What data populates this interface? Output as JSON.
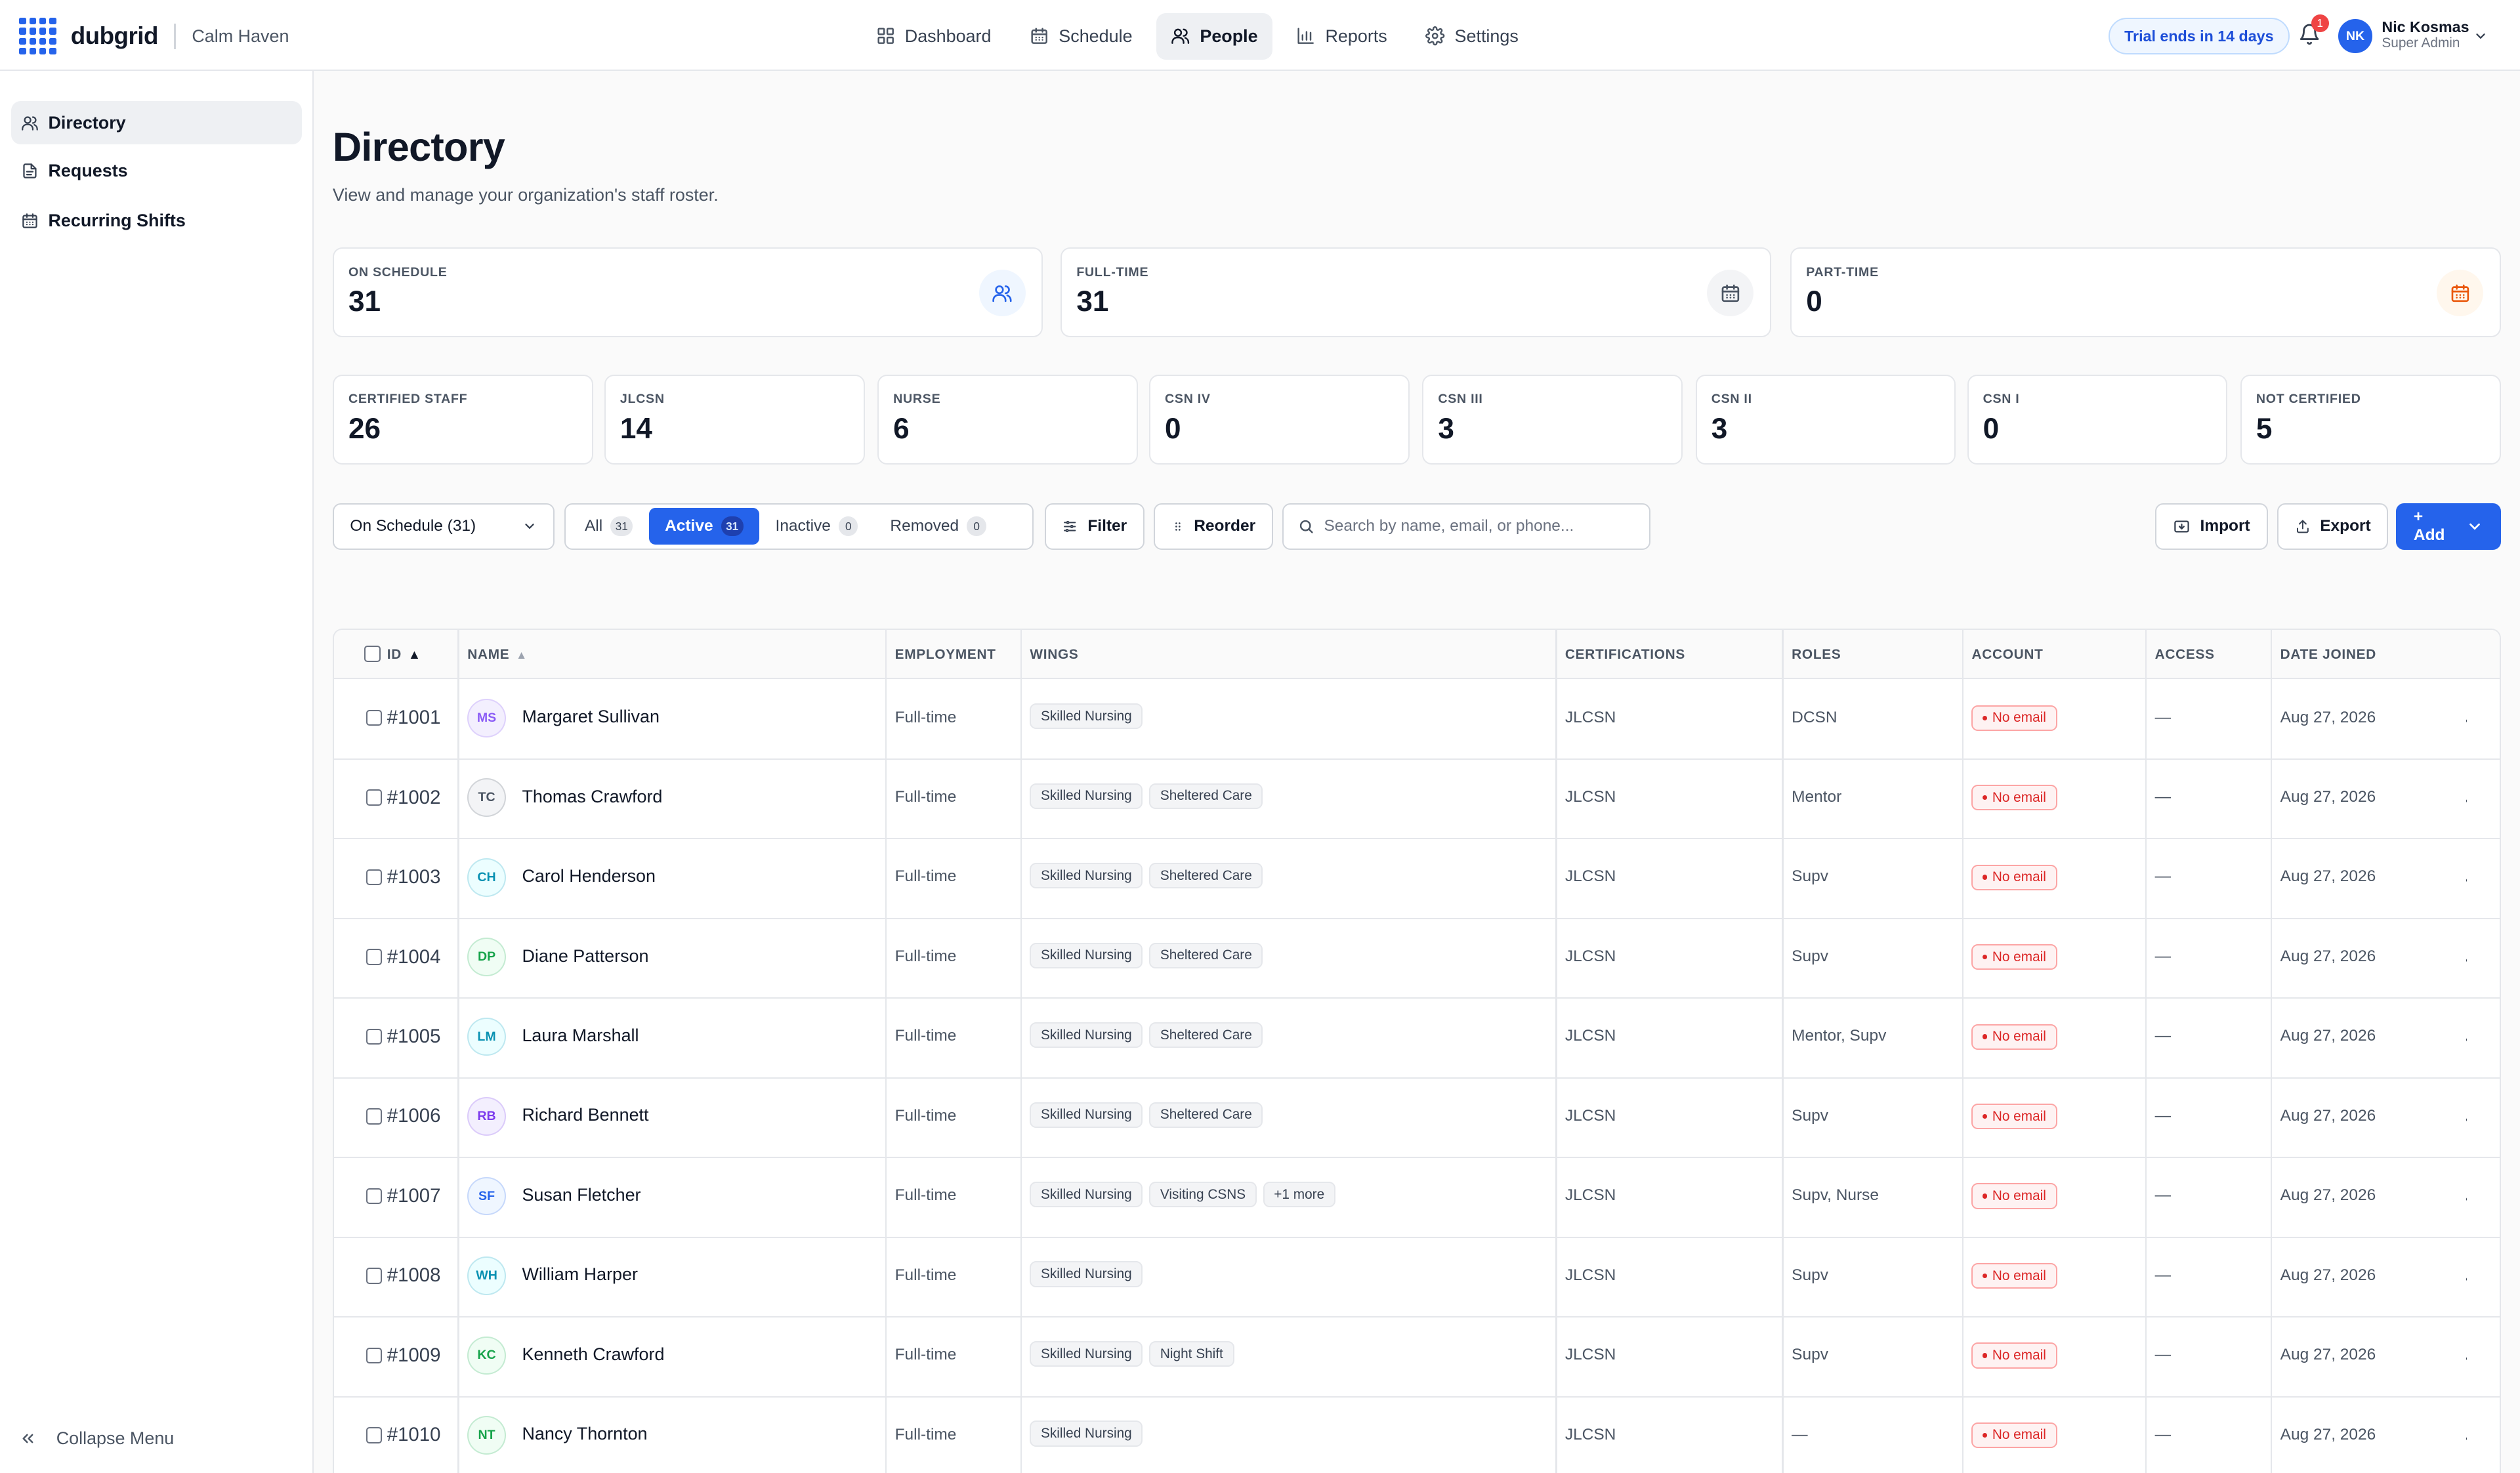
{
  "brand": {
    "name": "dubgrid",
    "org": "Calm Haven"
  },
  "nav": [
    {
      "label": "Dashboard",
      "icon": "dashboard-icon",
      "active": false
    },
    {
      "label": "Schedule",
      "icon": "calendar-icon",
      "active": false
    },
    {
      "label": "People",
      "icon": "people-icon",
      "active": true
    },
    {
      "label": "Reports",
      "icon": "bar-chart-icon",
      "active": false
    },
    {
      "label": "Settings",
      "icon": "gear-icon",
      "active": false
    }
  ],
  "header": {
    "trial": "Trial ends in 14 days",
    "notifications": "1",
    "user_initials": "NK",
    "user_name": "Nic Kosmas",
    "user_role": "Super Admin"
  },
  "sidebar": {
    "items": [
      {
        "label": "Directory",
        "icon": "users-icon",
        "active": true
      },
      {
        "label": "Requests",
        "icon": "document-icon",
        "active": false
      },
      {
        "label": "Recurring Shifts",
        "icon": "calendar-icon",
        "active": false
      }
    ],
    "collapse": "Collapse Menu"
  },
  "page": {
    "title": "Directory",
    "subtitle": "View and manage your organization's staff roster."
  },
  "stats_top": [
    {
      "label": "ON SCHEDULE",
      "value": "31",
      "icon": "people-icon",
      "accent": "#2563eb",
      "bg": "#eff6ff"
    },
    {
      "label": "FULL-TIME",
      "value": "31",
      "icon": "calendar-icon",
      "accent": "#4b5563",
      "bg": "#f3f4f6"
    },
    {
      "label": "PART-TIME",
      "value": "0",
      "icon": "calendar-icon",
      "accent": "#ea580c",
      "bg": "#fff7ed"
    }
  ],
  "stats_cert": [
    {
      "label": "CERTIFIED STAFF",
      "value": "26"
    },
    {
      "label": "JLCSN",
      "value": "14"
    },
    {
      "label": "NURSE",
      "value": "6"
    },
    {
      "label": "CSN IV",
      "value": "0"
    },
    {
      "label": "CSN III",
      "value": "3"
    },
    {
      "label": "CSN II",
      "value": "3"
    },
    {
      "label": "CSN I",
      "value": "0"
    },
    {
      "label": "NOT CERTIFIED",
      "value": "5"
    }
  ],
  "toolbar": {
    "schedule_select": "On Schedule (31)",
    "segments": [
      {
        "label": "All",
        "count": "31",
        "active": false
      },
      {
        "label": "Active",
        "count": "31",
        "active": true
      },
      {
        "label": "Inactive",
        "count": "0",
        "active": false
      },
      {
        "label": "Removed",
        "count": "0",
        "active": false
      }
    ],
    "filter": "Filter",
    "reorder": "Reorder",
    "search_placeholder": "Search by name, email, or phone...",
    "import": "Import",
    "export": "Export",
    "add": "+ Add"
  },
  "table": {
    "columns": [
      "ID",
      "NAME",
      "EMPLOYMENT",
      "WINGS",
      "CERTIFICATIONS",
      "ROLES",
      "ACCOUNT",
      "ACCESS",
      "DATE JOINED"
    ],
    "rows": [
      {
        "id": "#1001",
        "initials": "MS",
        "name": "Margaret Sullivan",
        "employment": "Full-time",
        "wings": [
          "Skilled Nursing"
        ],
        "cert": "JLCSN",
        "roles": "DCSN",
        "account": "No email",
        "access": "—",
        "joined": "Aug 27, 2026",
        "color": "#8b5cf6",
        "bg": "#f3effe"
      },
      {
        "id": "#1002",
        "initials": "TC",
        "name": "Thomas Crawford",
        "employment": "Full-time",
        "wings": [
          "Skilled Nursing",
          "Sheltered Care"
        ],
        "cert": "JLCSN",
        "roles": "Mentor",
        "account": "No email",
        "access": "—",
        "joined": "Aug 27, 2026",
        "color": "#4b5563",
        "bg": "#f3f4f6"
      },
      {
        "id": "#1003",
        "initials": "CH",
        "name": "Carol Henderson",
        "employment": "Full-time",
        "wings": [
          "Skilled Nursing",
          "Sheltered Care"
        ],
        "cert": "JLCSN",
        "roles": "Supv",
        "account": "No email",
        "access": "—",
        "joined": "Aug 27, 2026",
        "color": "#0891b2",
        "bg": "#ecfeff"
      },
      {
        "id": "#1004",
        "initials": "DP",
        "name": "Diane Patterson",
        "employment": "Full-time",
        "wings": [
          "Skilled Nursing",
          "Sheltered Care"
        ],
        "cert": "JLCSN",
        "roles": "Supv",
        "account": "No email",
        "access": "—",
        "joined": "Aug 27, 2026",
        "color": "#16a34a",
        "bg": "#f0fdf4"
      },
      {
        "id": "#1005",
        "initials": "LM",
        "name": "Laura Marshall",
        "employment": "Full-time",
        "wings": [
          "Skilled Nursing",
          "Sheltered Care"
        ],
        "cert": "JLCSN",
        "roles": "Mentor, Supv",
        "account": "No email",
        "access": "—",
        "joined": "Aug 27, 2026",
        "color": "#0891b2",
        "bg": "#ecfeff"
      },
      {
        "id": "#1006",
        "initials": "RB",
        "name": "Richard Bennett",
        "employment": "Full-time",
        "wings": [
          "Skilled Nursing",
          "Sheltered Care"
        ],
        "cert": "JLCSN",
        "roles": "Supv",
        "account": "No email",
        "access": "—",
        "joined": "Aug 27, 2026",
        "color": "#7c3aed",
        "bg": "#f3effe"
      },
      {
        "id": "#1007",
        "initials": "SF",
        "name": "Susan Fletcher",
        "employment": "Full-time",
        "wings": [
          "Skilled Nursing",
          "Visiting CSNS",
          "+1 more"
        ],
        "cert": "JLCSN",
        "roles": "Supv, Nurse",
        "account": "No email",
        "access": "—",
        "joined": "Aug 27, 2026",
        "color": "#2563eb",
        "bg": "#eff6ff"
      },
      {
        "id": "#1008",
        "initials": "WH",
        "name": "William Harper",
        "employment": "Full-time",
        "wings": [
          "Skilled Nursing"
        ],
        "cert": "JLCSN",
        "roles": "Supv",
        "account": "No email",
        "access": "—",
        "joined": "Aug 27, 2026",
        "color": "#0891b2",
        "bg": "#ecfeff"
      },
      {
        "id": "#1009",
        "initials": "KC",
        "name": "Kenneth Crawford",
        "employment": "Full-time",
        "wings": [
          "Skilled Nursing",
          "Night Shift"
        ],
        "cert": "JLCSN",
        "roles": "Supv",
        "account": "No email",
        "access": "—",
        "joined": "Aug 27, 2026",
        "color": "#16a34a",
        "bg": "#f0fdf4"
      },
      {
        "id": "#1010",
        "initials": "NT",
        "name": "Nancy Thornton",
        "employment": "Full-time",
        "wings": [
          "Skilled Nursing"
        ],
        "cert": "JLCSN",
        "roles": "—",
        "account": "No email",
        "access": "—",
        "joined": "Aug 27, 2026",
        "color": "#16a34a",
        "bg": "#f0fdf4"
      }
    ]
  }
}
